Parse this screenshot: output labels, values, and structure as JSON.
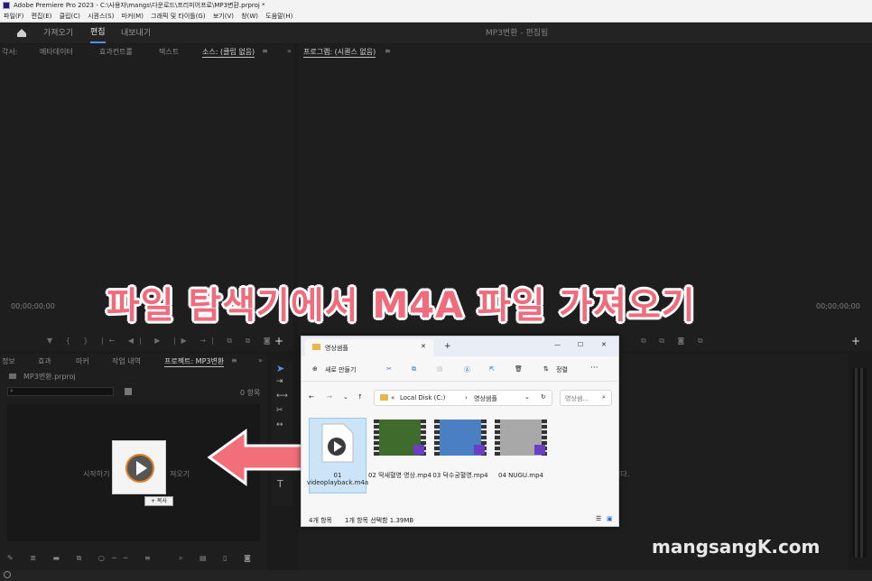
{
  "window": {
    "title": "Adobe Premiere Pro 2023 - C:\\사용자\\mangs\\다운로드\\프리미어프로\\MP3변환.prproj *"
  },
  "menu": [
    "파일(F)",
    "편집(E)",
    "클립(C)",
    "시퀀스(S)",
    "마커(M)",
    "그래픽 및 타이틀(G)",
    "보기(V)",
    "창(W)",
    "도움말(H)"
  ],
  "workspace": {
    "tabs": [
      "가져오기",
      "편집",
      "내보내기"
    ],
    "active": "편집",
    "project_title": "MP3변환 - 편집됨"
  },
  "source_panel": {
    "tabs": [
      "각서:",
      "메타데이터",
      "효과컨트롤",
      "텍스트",
      "소스: (클립 없음)"
    ],
    "timecode": "00;00;00;00"
  },
  "program_panel": {
    "tab": "프로그램: (시퀀스 없음)",
    "timecode": "00;00;00;00"
  },
  "project_panel": {
    "tabs": [
      "정보",
      "효과",
      "마커",
      "작업 내역",
      "프로젝트: MP3변환"
    ],
    "file": "MP3변환.prproj",
    "item_count": "0 항목",
    "hint_left": "시작하기",
    "hint_right": "져오기"
  },
  "overlay_caption": "파일 탐색기에서 M4A 파일 가져오기",
  "drag": {
    "copy_label": "+ 복사"
  },
  "explorer": {
    "tab_title": "영상샘플",
    "new_button": "새로 만들기",
    "sort_button": "정렬",
    "address": [
      "Local Disk (C:)",
      "영상샘플"
    ],
    "search_placeholder": "영상샘...",
    "files": [
      {
        "name": "01 videoplayback.m4a",
        "type": "audio"
      },
      {
        "name": "02 딱새혈영 영상.mp4",
        "type": "video"
      },
      {
        "name": "03 덕수궁혈영.mp4",
        "type": "video"
      },
      {
        "name": "04 NUGU.mp4",
        "type": "video"
      }
    ],
    "status": {
      "count": "4개 항목",
      "selected": "1개 항목 선택함 1.39MB"
    }
  },
  "timeline_hint": "니다.",
  "watermark": "mangsangK.com",
  "colors": {
    "accent": "#5b8ee6",
    "caption": "#f06c7c",
    "arrow": "#f26e78"
  }
}
